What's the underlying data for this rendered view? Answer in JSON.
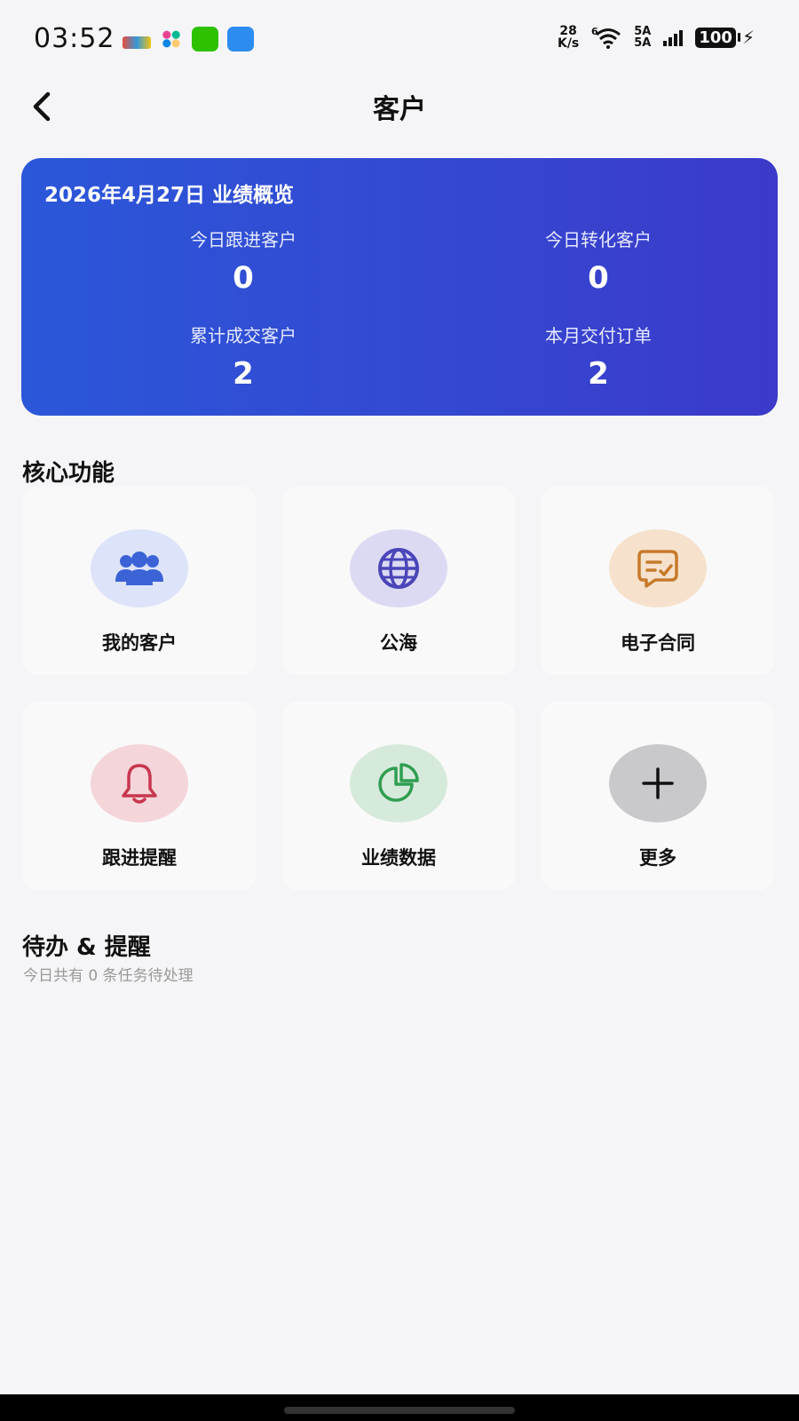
{
  "status_bar": {
    "time": "03:52",
    "net_speed_value": "28",
    "net_speed_unit": "K/s",
    "wifi_label": "6",
    "sig1": "5A",
    "sig2": "5A",
    "battery": "100"
  },
  "nav": {
    "title": "客户",
    "back_icon": "chevron-left-icon"
  },
  "overview": {
    "title": "2026年4月27日 业绩概览",
    "stats": [
      {
        "label": "今日跟进客户",
        "value": "0"
      },
      {
        "label": "今日转化客户",
        "value": "0"
      },
      {
        "label": "累计成交客户",
        "value": "2"
      },
      {
        "label": "本月交付订单",
        "value": "2"
      }
    ],
    "gradient_start": "#2b57d9",
    "gradient_end": "#3b3ac9"
  },
  "core": {
    "title": "核心功能",
    "items": [
      {
        "label": "我的客户",
        "icon": "users-icon",
        "bg": "#dde4fa",
        "fg": "#3b63d6"
      },
      {
        "label": "公海",
        "icon": "globe-icon",
        "bg": "#dcdaf3",
        "fg": "#4a45b8"
      },
      {
        "label": "电子合同",
        "icon": "contract-icon",
        "bg": "#f6e2cc",
        "fg": "#c77a2a"
      },
      {
        "label": "跟进提醒",
        "icon": "bell-icon",
        "bg": "#f4d5d9",
        "fg": "#c7374f"
      },
      {
        "label": "业绩数据",
        "icon": "pie-chart-icon",
        "bg": "#d6eadb",
        "fg": "#2f9e52"
      },
      {
        "label": "更多",
        "icon": "plus-icon",
        "bg": "#c9c9cc",
        "fg": "#111111"
      }
    ]
  },
  "todo": {
    "title": "待办 & 提醒",
    "subtitle": "今日共有 0 条任务待处理"
  }
}
